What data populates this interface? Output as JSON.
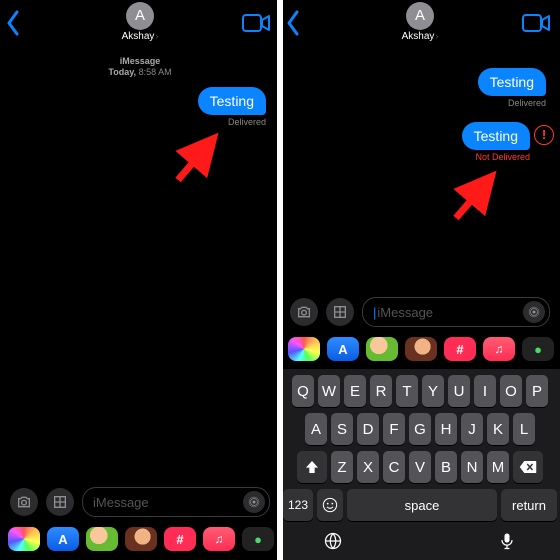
{
  "contact": {
    "initial": "A",
    "name": "Akshay"
  },
  "stamp": {
    "service": "iMessage",
    "day": "Today,",
    "time": "8:58 AM"
  },
  "msg": {
    "m1": "Testing",
    "delivered": "Delivered",
    "m2": "Testing",
    "notDelivered": "Not Delivered"
  },
  "input": {
    "placeholder": "iMessage"
  },
  "keys": {
    "r1": [
      "Q",
      "W",
      "E",
      "R",
      "T",
      "Y",
      "U",
      "I",
      "O",
      "P"
    ],
    "r2": [
      "A",
      "S",
      "D",
      "F",
      "G",
      "H",
      "J",
      "K",
      "L"
    ],
    "r3": [
      "Z",
      "X",
      "C",
      "V",
      "B",
      "N",
      "M"
    ],
    "num": "123",
    "space": "space",
    "ret": "return"
  }
}
